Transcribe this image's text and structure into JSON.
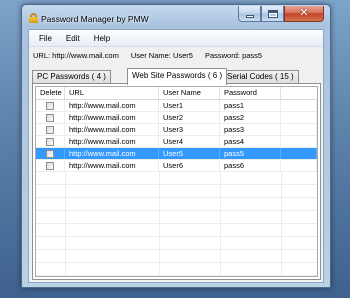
{
  "window": {
    "title": "Password Manager by PMW",
    "icon": "padlock-icon"
  },
  "caption_buttons": {
    "close_glyph": "✕"
  },
  "menu": {
    "items": [
      {
        "label": "File"
      },
      {
        "label": "Edit"
      },
      {
        "label": "Help"
      }
    ]
  },
  "info": {
    "url": "URL:  http://www.mail.com",
    "user_name": "User Name:  User5",
    "password": "Password:  pass5"
  },
  "tabs": [
    {
      "label": "PC Passwords ( 4 )",
      "active": false
    },
    {
      "label": "Web Site Passwords ( 6 )",
      "active": true
    },
    {
      "label": "Serial Codes ( 15 )",
      "active": false
    }
  ],
  "grid": {
    "columns": [
      "Delete",
      "URL",
      "User Name",
      "Password",
      ""
    ],
    "rows": [
      {
        "url": "http://www.mail.com",
        "user": "User1",
        "password": "pass1",
        "selected": false
      },
      {
        "url": "http://www.mail.com",
        "user": "User2",
        "password": "pass2",
        "selected": false
      },
      {
        "url": "http://www.mail.com",
        "user": "User3",
        "password": "pass3",
        "selected": false
      },
      {
        "url": "http://www.mail.com",
        "user": "User4",
        "password": "pass4",
        "selected": false
      },
      {
        "url": "http://www.mail.com",
        "user": "User5",
        "password": "pass5",
        "selected": true
      },
      {
        "url": "http://www.mail.com",
        "user": "User6",
        "password": "pass6",
        "selected": false
      }
    ]
  },
  "colors": {
    "selection": "#3399ff",
    "close_button": "#c2432a"
  }
}
